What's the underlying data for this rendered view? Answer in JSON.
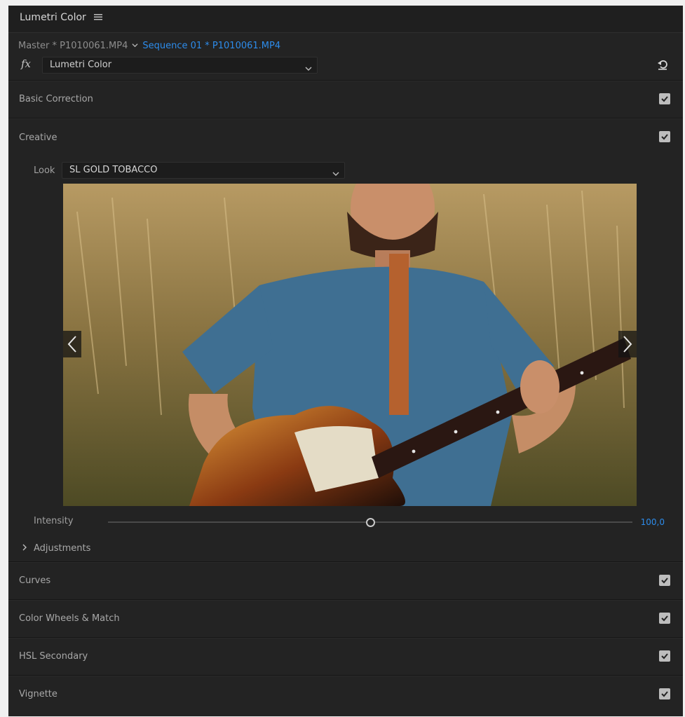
{
  "window": {
    "title": "Lumetri Color"
  },
  "source": {
    "master": "Master * P1010061.MP4",
    "sequence": "Sequence 01 * P1010061.MP4"
  },
  "effect": {
    "fx_label": "fx",
    "name": "Lumetri Color"
  },
  "sections": [
    {
      "label": "Basic Correction",
      "checked": true
    },
    {
      "label": "Creative",
      "checked": true
    },
    {
      "label": "Curves",
      "checked": true
    },
    {
      "label": "Color Wheels & Match",
      "checked": true
    },
    {
      "label": "HSL Secondary",
      "checked": true
    },
    {
      "label": "Vignette",
      "checked": true
    }
  ],
  "creative": {
    "look_label": "Look",
    "look_value": "SL GOLD TOBACCO",
    "intensity_label": "Intensity",
    "intensity_value": "100,0",
    "intensity_fraction": 0.5,
    "adjustments_label": "Adjustments"
  },
  "colors": {
    "accent": "#2d8ceb",
    "panel_bg": "#232323"
  }
}
